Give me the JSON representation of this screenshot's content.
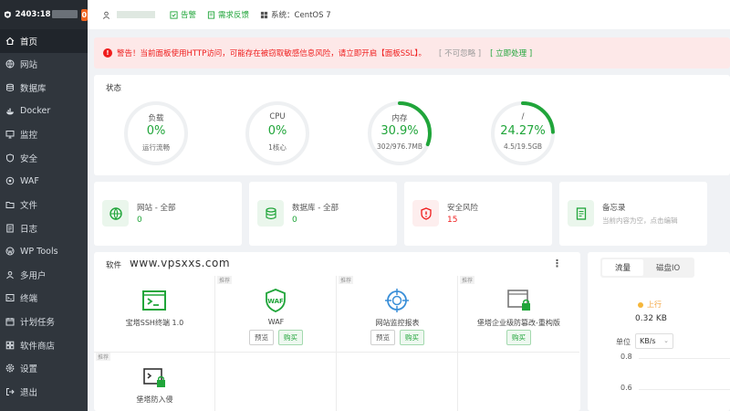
{
  "sidebar": {
    "ip": "2403:18",
    "badge": "0",
    "items": [
      {
        "label": "首页",
        "icon": "home-icon",
        "active": true
      },
      {
        "label": "网站",
        "icon": "globe-icon"
      },
      {
        "label": "数据库",
        "icon": "database-icon"
      },
      {
        "label": "Docker",
        "icon": "docker-icon"
      },
      {
        "label": "监控",
        "icon": "monitor-icon"
      },
      {
        "label": "安全",
        "icon": "shield-icon"
      },
      {
        "label": "WAF",
        "icon": "waf-icon"
      },
      {
        "label": "文件",
        "icon": "folder-icon"
      },
      {
        "label": "日志",
        "icon": "log-icon"
      },
      {
        "label": "WP Tools",
        "icon": "wordpress-icon"
      },
      {
        "label": "多用户",
        "icon": "users-icon"
      },
      {
        "label": "终端",
        "icon": "terminal-icon"
      },
      {
        "label": "计划任务",
        "icon": "calendar-icon"
      },
      {
        "label": "软件商店",
        "icon": "store-icon"
      },
      {
        "label": "设置",
        "icon": "gear-icon"
      },
      {
        "label": "退出",
        "icon": "logout-icon"
      }
    ]
  },
  "topbar": {
    "alarm": "告警",
    "feedback": "需求反馈",
    "system": "系统：CentOS 7"
  },
  "alert": {
    "text": "警告！当前面板使用HTTP访问，可能存在被窃取敏感信息风险，请立即开启【面板SSL】。",
    "ignore": "[ 不可忽略 ]",
    "fix": "[ 立即处理 ]"
  },
  "status": {
    "title": "状态",
    "gauges": [
      {
        "label": "负载",
        "value": "0%",
        "sub": "运行流畅",
        "percent": 0
      },
      {
        "label": "CPU",
        "value": "0%",
        "sub": "1核心",
        "percent": 0
      },
      {
        "label": "内存",
        "value": "30.9%",
        "sub": "302/976.7MB",
        "percent": 30.9
      },
      {
        "label": "/",
        "value": "24.27%",
        "sub": "4.5/19.5GB",
        "percent": 24.27
      }
    ]
  },
  "overview": [
    {
      "title": "网站 - 全部",
      "value": "0",
      "icon": "globe-icon"
    },
    {
      "title": "数据库 - 全部",
      "value": "0",
      "icon": "database-icon"
    },
    {
      "title": "安全风险",
      "value": "15",
      "icon": "shield-alert-icon"
    },
    {
      "title": "备忘录",
      "note": "当前内容为空，点击编辑",
      "icon": "memo-icon"
    }
  ],
  "software": {
    "title": "软件",
    "watermark": "www.vpsxxs.com",
    "apps": [
      {
        "name": "宝塔SSH终端 1.0",
        "tag": ""
      },
      {
        "name": "WAF",
        "tag": "推荐",
        "preview": "预览",
        "buy": "购买"
      },
      {
        "name": "网站监控报表",
        "tag": "推荐",
        "preview": "预览",
        "buy": "购买"
      },
      {
        "name": "堡塔企业级防篡改-重构版",
        "tag": "推荐",
        "buy": "购买"
      },
      {
        "name": "堡塔防入侵",
        "tag": "推荐"
      }
    ]
  },
  "traffic": {
    "tabs": [
      "流量",
      "磁盘IO"
    ],
    "legend": "上行",
    "up_value": "0.32 KB",
    "unit_label": "单位",
    "unit": "KB/s",
    "yticks": [
      "0.8",
      "0.6"
    ]
  },
  "colors": {
    "accent": "#20a53a",
    "danger": "#ef1c1c",
    "sidebar": "#30363d"
  }
}
